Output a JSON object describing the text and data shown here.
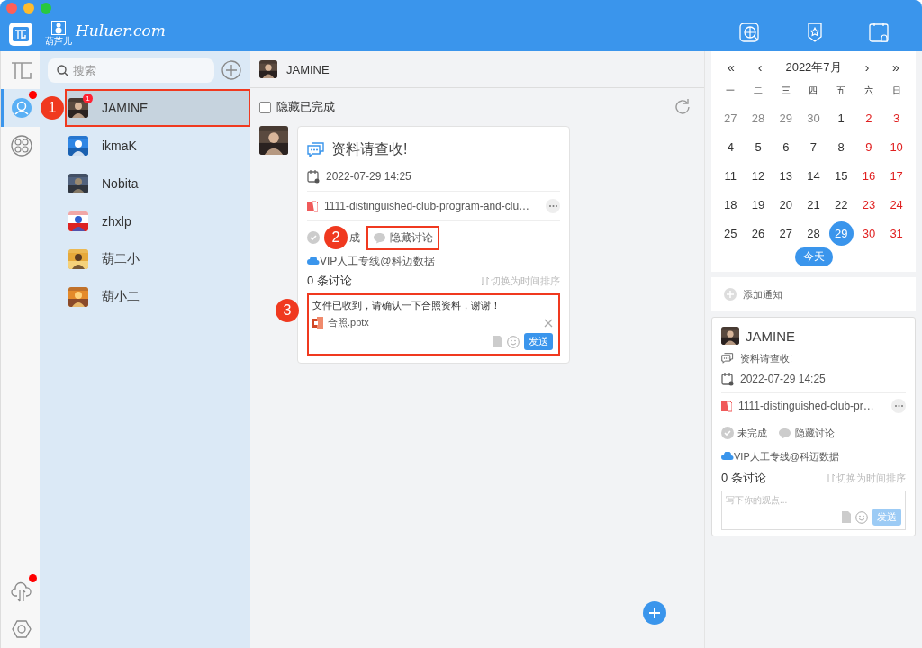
{
  "header": {
    "logo_text": "Huluer.com",
    "logo_caption": "葫芦儿"
  },
  "rail": {
    "items": [
      {
        "kind": "brand",
        "selected": false,
        "dot": false
      },
      {
        "kind": "contacts",
        "selected": true,
        "dot": true
      },
      {
        "kind": "apps",
        "selected": false,
        "dot": false
      }
    ],
    "bottom": [
      {
        "kind": "sync",
        "dot": true
      },
      {
        "kind": "settings",
        "dot": false
      }
    ]
  },
  "contacts": {
    "search": {
      "placeholder": "搜索"
    },
    "items": [
      {
        "name": "JAMINE",
        "selected": true,
        "badge": "1",
        "annotation": "1"
      },
      {
        "name": "ikmaK",
        "selected": false
      },
      {
        "name": "Nobita",
        "selected": false
      },
      {
        "name": "zhxlp",
        "selected": false
      },
      {
        "name": "葫二小",
        "selected": false
      },
      {
        "name": "葫小二",
        "selected": false
      }
    ]
  },
  "conversation": {
    "title": "JAMINE",
    "hide_done": {
      "label": "隐藏已完成",
      "checked": false
    },
    "task": {
      "title": "资料请查收!",
      "date": "2022-07-29 14:25",
      "file": "1111-distinguished-club-program-and-clu…",
      "status": "成",
      "done": false,
      "toggle": "隐藏讨论",
      "toggle_annotation": "2",
      "group": "VIP人工专线@科迈数据",
      "count": "0 条讨论",
      "sort": "切换为时间排序",
      "comment": {
        "value": "文件已收到，请确认一下合照资料，谢谢！",
        "attachment": "合照.pptx",
        "send": "发送",
        "annotation": "3"
      }
    }
  },
  "calendar": {
    "prev_year": "«",
    "prev_month": "‹",
    "month": "2022年7月",
    "next_month": "›",
    "next_year": "»",
    "weekdays": [
      "一",
      "二",
      "三",
      "四",
      "五",
      "六",
      "日"
    ],
    "weeks": [
      [
        {
          "d": "27",
          "muted": true,
          "selected": false
        },
        {
          "d": "28",
          "muted": true,
          "selected": false
        },
        {
          "d": "29",
          "muted": true,
          "selected": false
        },
        {
          "d": "30",
          "muted": true,
          "selected": false
        },
        {
          "d": "1",
          "muted": false,
          "selected": false
        },
        {
          "d": "2",
          "muted": false,
          "selected": false
        },
        {
          "d": "3",
          "muted": false,
          "selected": false
        }
      ],
      [
        {
          "d": "4",
          "muted": false,
          "selected": false
        },
        {
          "d": "5",
          "muted": false,
          "selected": false
        },
        {
          "d": "6",
          "muted": false,
          "selected": false
        },
        {
          "d": "7",
          "muted": false,
          "selected": false
        },
        {
          "d": "8",
          "muted": false,
          "selected": false
        },
        {
          "d": "9",
          "muted": false,
          "selected": false
        },
        {
          "d": "10",
          "muted": false,
          "selected": false
        }
      ],
      [
        {
          "d": "11",
          "muted": false,
          "selected": false
        },
        {
          "d": "12",
          "muted": false,
          "selected": false
        },
        {
          "d": "13",
          "muted": false,
          "selected": false
        },
        {
          "d": "14",
          "muted": false,
          "selected": false
        },
        {
          "d": "15",
          "muted": false,
          "selected": false
        },
        {
          "d": "16",
          "muted": false,
          "selected": false
        },
        {
          "d": "17",
          "muted": false,
          "selected": false
        }
      ],
      [
        {
          "d": "18",
          "muted": false,
          "selected": false
        },
        {
          "d": "19",
          "muted": false,
          "selected": false
        },
        {
          "d": "20",
          "muted": false,
          "selected": false
        },
        {
          "d": "21",
          "muted": false,
          "selected": false
        },
        {
          "d": "22",
          "muted": false,
          "selected": false
        },
        {
          "d": "23",
          "muted": false,
          "selected": false
        },
        {
          "d": "24",
          "muted": false,
          "selected": false
        }
      ],
      [
        {
          "d": "25",
          "muted": false,
          "selected": false
        },
        {
          "d": "26",
          "muted": false,
          "selected": false
        },
        {
          "d": "27",
          "muted": false,
          "selected": false
        },
        {
          "d": "28",
          "muted": false,
          "selected": false
        },
        {
          "d": "29",
          "muted": false,
          "selected": true
        },
        {
          "d": "30",
          "muted": false,
          "selected": false
        },
        {
          "d": "31",
          "muted": false,
          "selected": false
        }
      ]
    ],
    "today": "今天"
  },
  "add_notice": "添加通知",
  "preview": {
    "name": "JAMINE",
    "title": "资料请查收!",
    "date": "2022-07-29 14:25",
    "file": "1111-distinguished-club-pr…",
    "status": "未完成",
    "done": false,
    "toggle": "隐藏讨论",
    "group": "VIP人工专线@科迈数据",
    "count": "0 条讨论",
    "sort": "切换为时间排序",
    "placeholder": "写下你的观点...",
    "send": "发送"
  }
}
